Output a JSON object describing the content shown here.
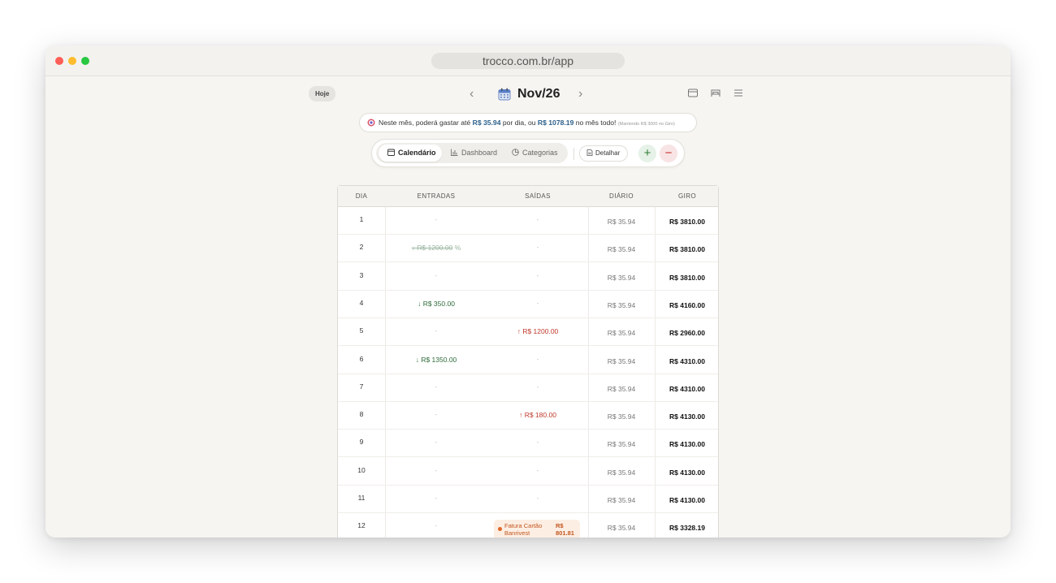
{
  "browser": {
    "url": "trocco.com.br/app"
  },
  "header": {
    "today_label": "Hoje",
    "month_label": "Nov/26",
    "prev_icon": "chevron-left-icon",
    "next_icon": "chevron-right-icon",
    "views": [
      "card-view-icon",
      "bed-view-icon",
      "list-view-icon"
    ]
  },
  "banner": {
    "prefix": "Neste mês, poderá gastar até",
    "daily": "R$ 35.94",
    "mid": "por dia, ou",
    "monthly": "R$ 1078.19",
    "suffix": "no mês todo!",
    "note": "(Mantendo R$ 3000 no Giro)"
  },
  "toolbar": {
    "tabs": [
      "Calendário",
      "Dashboard",
      "Categorias"
    ],
    "active_tab": "Calendário",
    "detail_label": "Detalhar",
    "add_symbol": "+",
    "remove_symbol": "−"
  },
  "table": {
    "headers": {
      "dia": "DIA",
      "entradas": "ENTRADAS",
      "saidas": "SAÍDAS",
      "diario": "DIÁRIO",
      "giro": "GIRO"
    },
    "empty_symbol": "-",
    "in_arrow": "↓",
    "out_arrow": "↑",
    "rows": [
      {
        "dia": "1",
        "entradas": "",
        "saidas": "",
        "diario": "R$ 35.94",
        "giro": "R$ 3810.00"
      },
      {
        "dia": "2",
        "entradas": "R$ 1200.00",
        "entradas_struck": true,
        "saidas": "",
        "diario": "R$ 35.94",
        "giro": "R$ 3810.00"
      },
      {
        "dia": "3",
        "entradas": "",
        "saidas": "",
        "diario": "R$ 35.94",
        "giro": "R$ 3810.00"
      },
      {
        "dia": "4",
        "entradas": "R$ 350.00",
        "saidas": "",
        "diario": "R$ 35.94",
        "giro": "R$ 4160.00"
      },
      {
        "dia": "5",
        "entradas": "",
        "saidas": "R$ 1200.00",
        "diario": "R$ 35.94",
        "giro": "R$ 2960.00"
      },
      {
        "dia": "6",
        "entradas": "R$ 1350.00",
        "saidas": "",
        "diario": "R$ 35.94",
        "giro": "R$ 4310.00"
      },
      {
        "dia": "7",
        "entradas": "",
        "saidas": "",
        "diario": "R$ 35.94",
        "giro": "R$ 4310.00"
      },
      {
        "dia": "8",
        "entradas": "",
        "saidas": "R$ 180.00",
        "diario": "R$ 35.94",
        "giro": "R$ 4130.00"
      },
      {
        "dia": "9",
        "entradas": "",
        "saidas": "",
        "diario": "R$ 35.94",
        "giro": "R$ 4130.00"
      },
      {
        "dia": "10",
        "entradas": "",
        "saidas": "",
        "diario": "R$ 35.94",
        "giro": "R$ 4130.00"
      },
      {
        "dia": "11",
        "entradas": "",
        "saidas": "",
        "diario": "R$ 35.94",
        "giro": "R$ 4130.00"
      },
      {
        "dia": "12",
        "entradas": "",
        "saidas": "",
        "saidas_chip": {
          "title": "Fatura Cartão Banrivest",
          "value": "R$ 801.81"
        },
        "diario": "R$ 35.94",
        "giro": "R$ 3328.19"
      }
    ]
  },
  "colors": {
    "income": "#2e6b3a",
    "expense": "#c0392b",
    "highlight": "#2b5f8a",
    "chip_bg": "#fdeee3"
  }
}
